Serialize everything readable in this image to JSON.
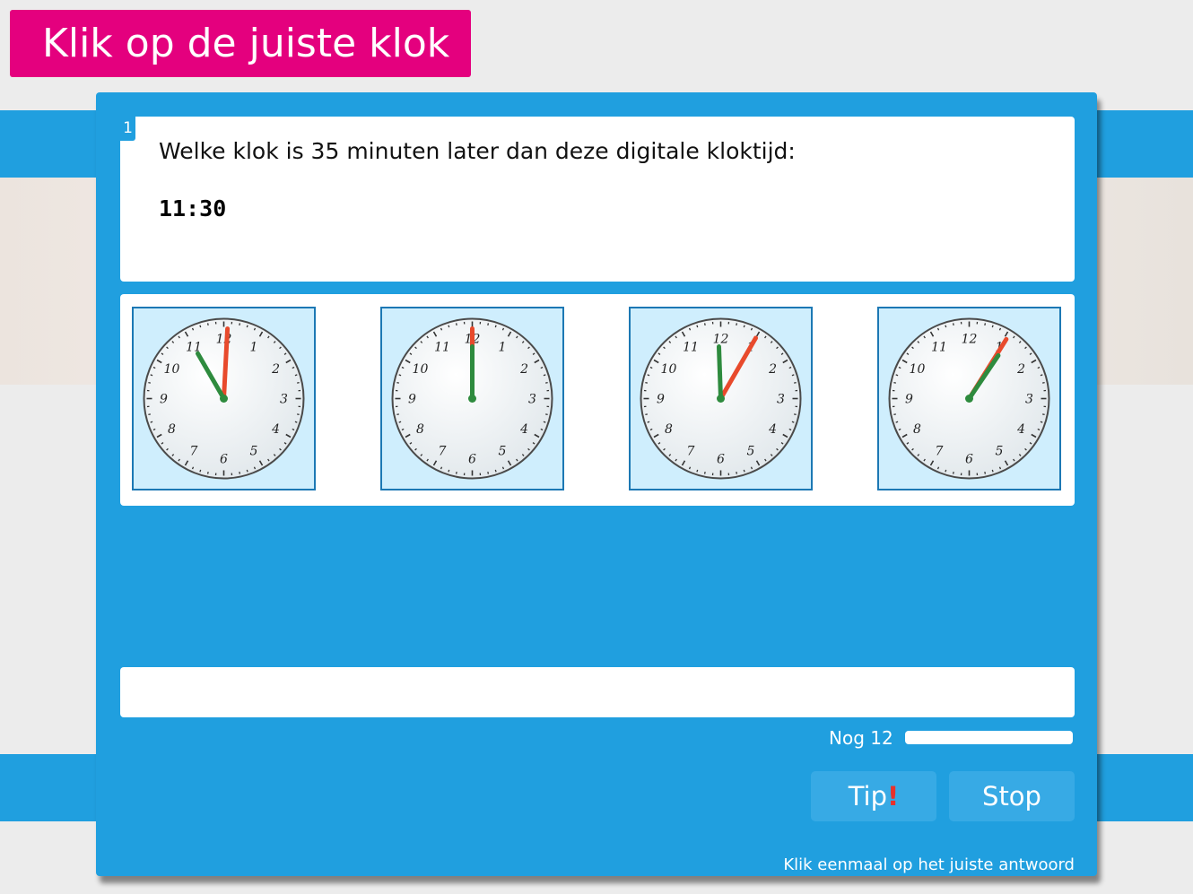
{
  "header": {
    "title": "Klik op de juiste klok"
  },
  "question": {
    "number": "1",
    "text": "Welke klok is 35 minuten later dan deze digitale kloktijd:",
    "time": "11:30"
  },
  "answers": [
    {
      "label": "clock-option-1",
      "hour_hand_deg": -30,
      "minute_hand_deg": 3
    },
    {
      "label": "clock-option-2",
      "hour_hand_deg": 0,
      "minute_hand_deg": 0
    },
    {
      "label": "clock-option-3",
      "hour_hand_deg": -2,
      "minute_hand_deg": 30
    },
    {
      "label": "clock-option-4",
      "hour_hand_deg": 34,
      "minute_hand_deg": 32
    }
  ],
  "clock_face": {
    "numerals": [
      "12",
      "1",
      "2",
      "3",
      "4",
      "5",
      "6",
      "7",
      "8",
      "9",
      "10",
      "11"
    ]
  },
  "status": {
    "remaining_label": "Nog 12",
    "progress_fraction": 1.0
  },
  "buttons": {
    "tip_label": "Tip",
    "tip_mark": "!",
    "stop_label": "Stop"
  },
  "footer": {
    "instruction": "Klik eenmaal op het juiste antwoord"
  },
  "colors": {
    "accent": "#209fdf",
    "title_bg": "#e4007e",
    "hour_hand": "#2e8b3e",
    "minute_hand": "#e84a2c"
  }
}
